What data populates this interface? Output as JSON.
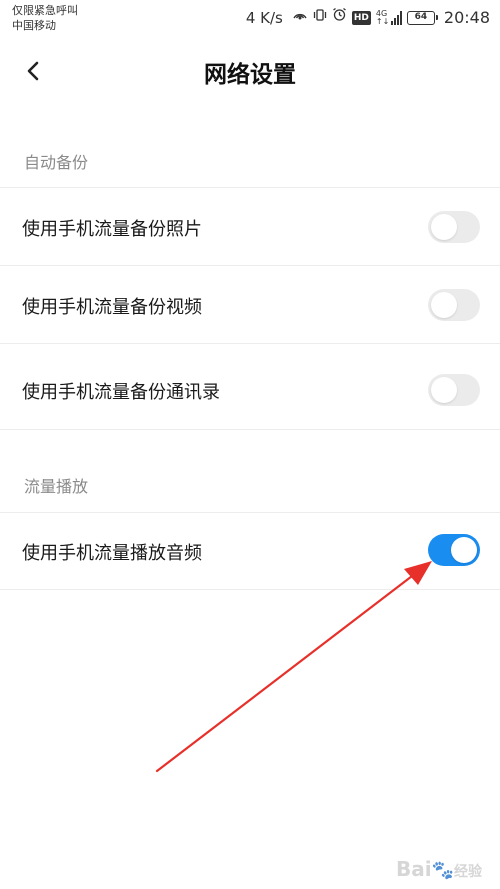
{
  "status_bar": {
    "carrier_line1": "仅限紧急呼叫",
    "carrier_line2": "中国移动",
    "net_speed": "4 K/s",
    "battery": "64",
    "time": "20:48",
    "icons": [
      "hotspot-icon",
      "vibrate-icon",
      "alarm-icon",
      "hd-icon",
      "4g-icon",
      "signal-icon",
      "battery-icon"
    ]
  },
  "header": {
    "title": "网络设置",
    "back_icon": "chevron-left-icon"
  },
  "sections": [
    {
      "title": "自动备份",
      "items": [
        {
          "label": "使用手机流量备份照片",
          "enabled": false
        },
        {
          "label": "使用手机流量备份视频",
          "enabled": false
        },
        {
          "label": "使用手机流量备份通讯录",
          "enabled": false
        }
      ]
    },
    {
      "title": "流量播放",
      "items": [
        {
          "label": "使用手机流量播放音频",
          "enabled": true
        }
      ]
    }
  ],
  "colors": {
    "accent": "#1a8df0",
    "toggle_off": "#ebebeb",
    "annotation_arrow": "#e8302a"
  },
  "watermark": {
    "text": "Bai",
    "suffix": "经验"
  }
}
